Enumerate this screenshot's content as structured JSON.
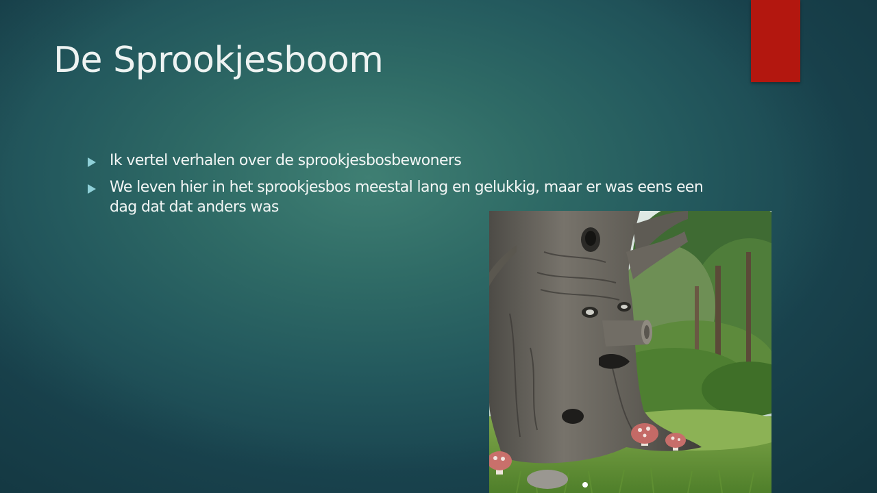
{
  "slide": {
    "title": "De Sprookjesboom",
    "bullets": [
      "Ik vertel verhalen over de sprookjesbosbewoners",
      "We leven hier in het sprookjesbos meestal lang en gelukkig, maar er was eens een dag dat dat anders was"
    ],
    "bullet_icon": "triangle-bullet-icon",
    "image": "fairy-tale-tree-photo"
  },
  "colors": {
    "background": "#2f6b66",
    "accent": "#b3170f",
    "bullet": "#8fd0d8",
    "text": "#f2f6f5"
  }
}
